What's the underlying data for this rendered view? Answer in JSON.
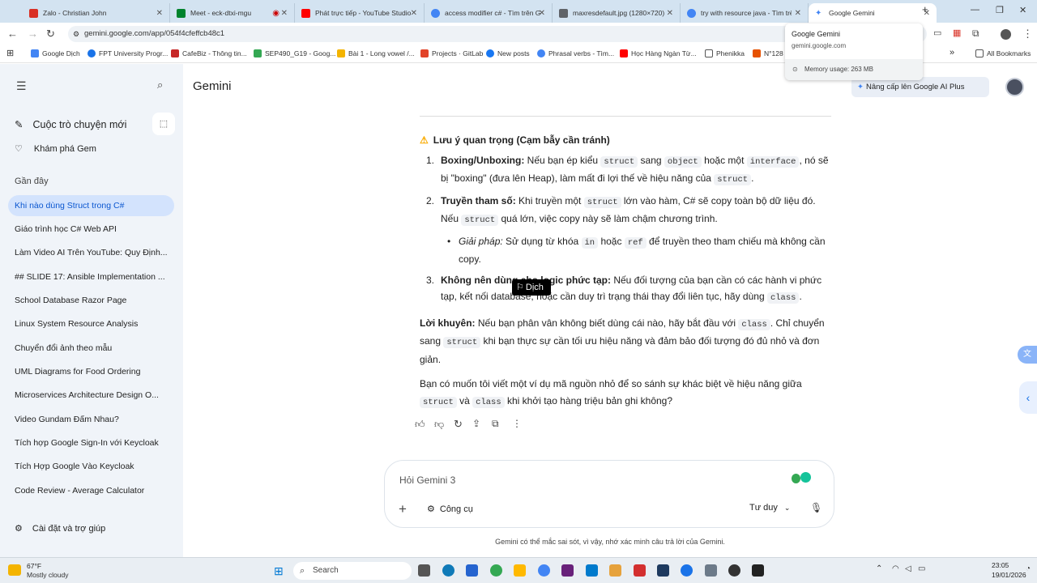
{
  "browser": {
    "tabs": [
      {
        "title": "Zalo - Christian John",
        "color": "#d93025"
      },
      {
        "title": "Meet - eck-dtxi-mgu",
        "color": "#00832d"
      },
      {
        "title": "Phát trực tiếp - YouTube Studio",
        "color": "#ff0000"
      },
      {
        "title": "access modifier c# - Tìm trên G",
        "color": "#4285f4"
      },
      {
        "title": "maxresdefault.jpg (1280×720)",
        "color": "#5f6368"
      },
      {
        "title": "try with resource java - Tìm trê",
        "color": "#4285f4"
      },
      {
        "title": "Google Gemini",
        "color": "#4285f4"
      }
    ],
    "url": "gemini.google.com/app/054f4cfeffcb48c1",
    "tooltip": {
      "title": "Google Gemini",
      "domain": "gemini.google.com",
      "memory": "Memory usage: 263 MB"
    },
    "bookmarks": [
      "Google Dịch",
      "FPT University Progr...",
      "CafeBiz - Thông tin...",
      "SEP490_G19 - Goog...",
      "Bài 1 - Long vowel /...",
      "Projects · GitLab",
      "New posts",
      "Phrasal verbs - Tìm...",
      "Học Hàng Ngàn Từ...",
      "Phenikka",
      "N°128"
    ],
    "all_bookmarks": "All Bookmarks"
  },
  "sidebar": {
    "new_chat": "Cuộc trò chuyện mới",
    "explore_gem": "Khám phá Gem",
    "recent_label": "Gần đây",
    "recent": [
      "Khi nào dùng Struct trong C#",
      "Giáo trình học C# Web API",
      "Làm Video AI Trên YouTube: Quy Định...",
      "## SLIDE 17: Ansible Implementation ...",
      "School Database Razor Page",
      "Linux System Resource Analysis",
      "Chuyển đổi ảnh theo mẫu",
      "UML Diagrams for Food Ordering",
      "Microservices Architecture Design O...",
      "Video Gundam Đấm Nhau?",
      "Tích hợp Google Sign-In với Keycloak",
      "Tích Hợp Google Vào Keycloak",
      "Code Review - Average Calculator"
    ],
    "settings": "Cài đặt và trợ giúp"
  },
  "header": {
    "title": "Gemini",
    "upgrade": "Nâng cấp lên Google AI Plus"
  },
  "chat": {
    "heading": "Lưu ý quan trọng (Cạm bẫy cần tránh)",
    "items": {
      "n1": "1.",
      "t1": "Boxing/Unboxing:",
      "a1": " Nếu bạn ép kiểu ",
      "c1": "struct",
      "b1": " sang ",
      "c2": "object",
      "d1": " hoặc một ",
      "c3": "interface",
      "e1": ", nó sẽ bị \"boxing\" (đưa lên Heap), làm mất đi lợi thế về hiệu năng của ",
      "c4": "struct",
      "f1": ".",
      "n2": "2.",
      "t2": "Truyền tham số:",
      "a2": " Khi truyền một ",
      "c5": "struct",
      "b2": " lớn vào hàm, C# sẽ copy toàn bộ dữ liệu đó. Nếu ",
      "c6": "struct",
      "d2": " quá lớn, việc copy này sẽ làm chậm chương trình.",
      "sub_dot": "•",
      "sub_em": "Giải pháp:",
      "sub_a": " Sử dụng từ khóa ",
      "c7": "in",
      "sub_b": " hoặc ",
      "c8": "ref",
      "sub_c": " để truyền theo tham chiếu mà không cần copy.",
      "n3": "3.",
      "t3": "Không nên dùng cho logic phức tạp:",
      "a3": " Nếu đối tượng của bạn cần có các hành vi phức tạp, kết nối data",
      "hidden3": "base, hoặc c",
      "b3": "ần duy trì trạng thái thay đổi liên tục, hãy dùng ",
      "c9": "class",
      "d3": "."
    },
    "advice_label": "Lời khuyên:",
    "advice_a": " Nếu bạn phân vân không biết dùng cái nào, hãy bắt đầu với ",
    "c10": "class",
    "advice_b": ". Chỉ chuyển sang ",
    "c11": "struct",
    "advice_c": " khi bạn thực sự cần tối ưu hiệu năng và đảm bảo đối tượng đó đủ nhỏ và đơn giản.",
    "question_a": "Bạn có muốn tôi viết một ví dụ mã nguồn nhỏ để so sánh sự khác biệt về hiệu năng giữa ",
    "c12": "struct",
    "question_b": " và ",
    "c13": "class",
    "question_c": " khi khởi tạo hàng triệu bản ghi không?",
    "translate_popup": "Dịch"
  },
  "input": {
    "placeholder": "Hỏi Gemini 3",
    "tools": "Công cụ",
    "mode": "Tư duy"
  },
  "disclaimer": "Gemini có thể mắc sai sót, vì vậy, nhớ xác minh câu trả lời của Gemini.",
  "taskbar": {
    "weather_temp": "67°F",
    "weather_desc": "Mostly cloudy",
    "search": "Search",
    "time": "23:05",
    "date": "19/01/2026"
  }
}
